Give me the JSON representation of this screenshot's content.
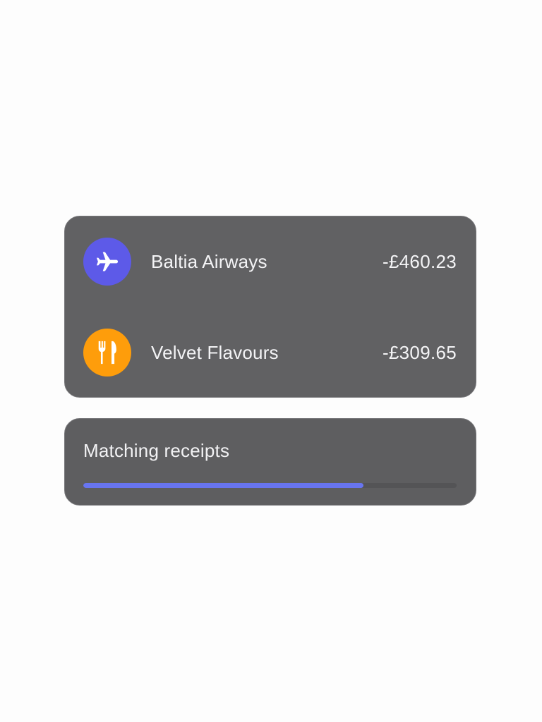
{
  "transactions": [
    {
      "merchant": "Baltia Airways",
      "amount": "-£460.23",
      "icon": "airplane-icon",
      "icon_color": "#5d5ae8"
    },
    {
      "merchant": "Velvet Flavours",
      "amount": "-£309.65",
      "icon": "fork-knife-icon",
      "icon_color": "#fe9d0b"
    }
  ],
  "progress": {
    "label": "Matching receipts",
    "fraction": 0.75,
    "fill_color": "#6875f0",
    "track_color": "#545456"
  },
  "colors": {
    "card_background": "#616163",
    "page_background": "#fdfdfd",
    "text": "#f4f4f6"
  }
}
